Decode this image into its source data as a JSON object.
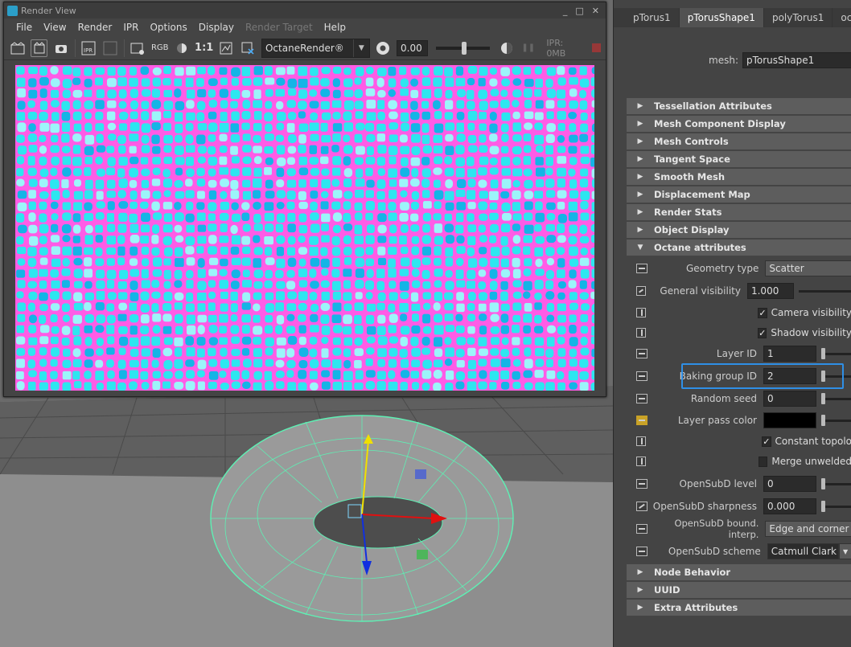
{
  "render_view": {
    "title": "Render View",
    "menu": [
      {
        "label": "File",
        "disabled": false
      },
      {
        "label": "View",
        "disabled": false
      },
      {
        "label": "Render",
        "disabled": false
      },
      {
        "label": "IPR",
        "disabled": false
      },
      {
        "label": "Options",
        "disabled": false
      },
      {
        "label": "Display",
        "disabled": false
      },
      {
        "label": "Render Target",
        "disabled": true
      },
      {
        "label": "Help",
        "disabled": false
      }
    ],
    "toolbar": {
      "rgb_label": "RGB",
      "ratio_label": "1:1",
      "renderer": "OctaneRender®",
      "exposure": "0.00",
      "exposure_level": 0.5,
      "ipr_mem": "IPR: 0MB",
      "ipr_label": "IPR"
    }
  },
  "attribute_editor": {
    "tabs": [
      {
        "label": "pTorus1",
        "active": false
      },
      {
        "label": "pTorusShape1",
        "active": true
      },
      {
        "label": "polyTorus1",
        "active": false
      },
      {
        "label": "octane",
        "active": false
      }
    ],
    "mesh_label": "mesh:",
    "mesh_value": "pTorusShape1",
    "sections": [
      "Tessellation Attributes",
      "Mesh Component Display",
      "Mesh Controls",
      "Tangent Space",
      "Smooth Mesh",
      "Displacement Map",
      "Render Stats",
      "Object Display",
      "Octane attributes"
    ],
    "octane": {
      "geometry_type": {
        "label": "Geometry type",
        "value": "Scatter"
      },
      "general_visibility": {
        "label": "General visibility",
        "value": "1.000"
      },
      "camera_visibility": {
        "label": "Camera visibility",
        "checked": true
      },
      "shadow_visibility": {
        "label": "Shadow visibility",
        "checked": true
      },
      "layer_id": {
        "label": "Layer ID",
        "value": "1"
      },
      "baking_group_id": {
        "label": "Baking group ID",
        "value": "2"
      },
      "random_seed": {
        "label": "Random seed",
        "value": "0"
      },
      "layer_pass_color": {
        "label": "Layer pass color",
        "value": "#000000"
      },
      "constant_topology": {
        "label": "Constant topolo",
        "checked": true
      },
      "merge_unwelded": {
        "label": "Merge unwelded",
        "checked": false
      },
      "opensubd_level": {
        "label": "OpenSubD level",
        "value": "0"
      },
      "opensubd_sharpness": {
        "label": "OpenSubD sharpness",
        "value": "0.000"
      },
      "opensubd_bound": {
        "label": "OpenSubD bound. interp.",
        "value": "Edge and corner"
      },
      "opensubd_scheme": {
        "label": "OpenSubD scheme",
        "value": "Catmull Clark"
      }
    },
    "bottom_sections": [
      "Node Behavior",
      "UUID",
      "Extra Attributes"
    ]
  },
  "colors": {
    "render_cyan": "#2de6f0",
    "render_magenta": "#ff5ce6",
    "wire": "#5ef0b4",
    "highlight": "#2f8fe6"
  }
}
